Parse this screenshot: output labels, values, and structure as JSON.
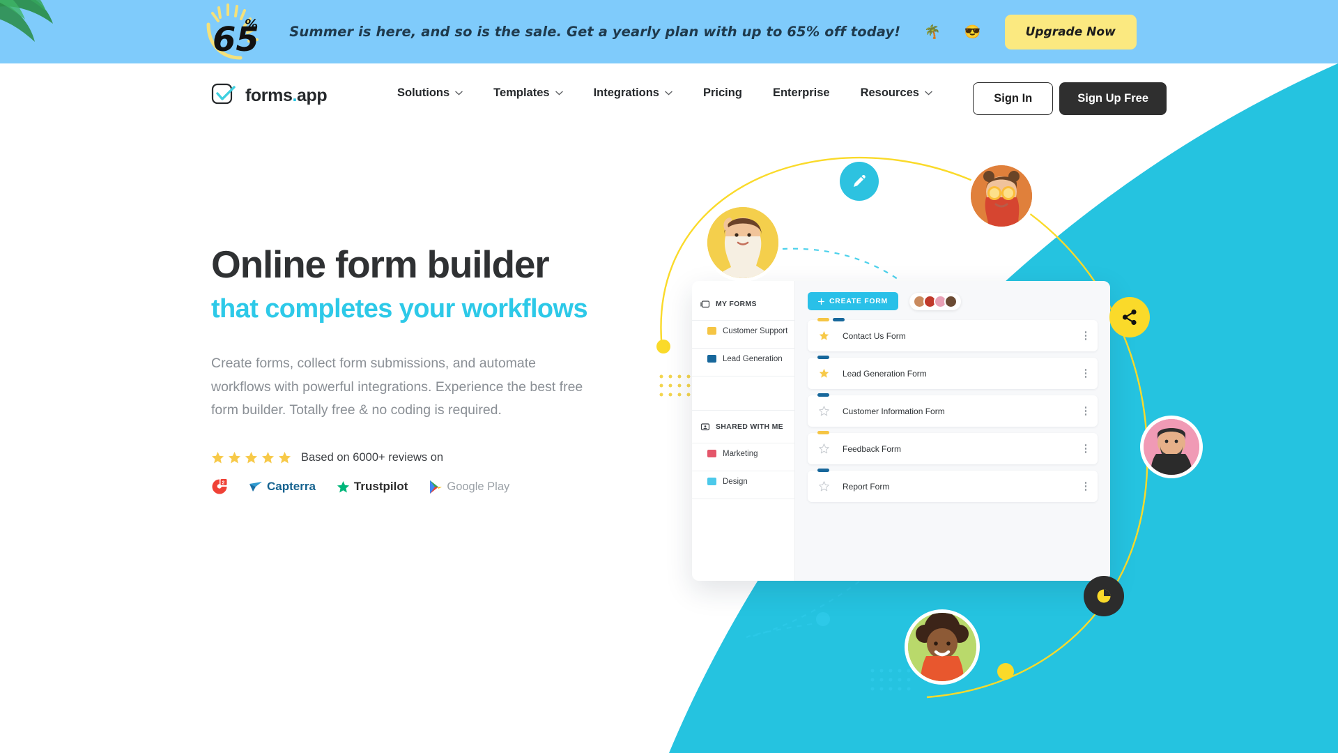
{
  "promo": {
    "badge_number": "65",
    "badge_percent": "%",
    "message": "Summer is here, and so is the sale. Get a yearly plan with up to 65% off today!",
    "emoji_palm": "🌴",
    "emoji_sun": "😎",
    "cta_label": "Upgrade Now",
    "bg_color": "#7fcbfb",
    "cta_bg_color": "#fbe980"
  },
  "nav": {
    "logo_text": "forms",
    "logo_dot": ".",
    "logo_suffix": "app",
    "items": [
      {
        "label": "Solutions",
        "has_caret": true
      },
      {
        "label": "Templates",
        "has_caret": true
      },
      {
        "label": "Integrations",
        "has_caret": true
      },
      {
        "label": "Pricing",
        "has_caret": false
      },
      {
        "label": "Enterprise",
        "has_caret": false
      },
      {
        "label": "Resources",
        "has_caret": true
      }
    ],
    "sign_in_label": "Sign In",
    "sign_up_label": "Sign Up Free"
  },
  "hero": {
    "title": "Online form builder",
    "subtitle": "that completes your workflows",
    "paragraph": "Create forms, collect form submissions, and automate workflows with powerful integrations. Experience the best free form builder. Totally free & no coding is required.",
    "rating_text": "Based on 6000+ reviews on",
    "star_count": 5,
    "star_color": "#f7c948",
    "accent_color": "#2dc9e8",
    "badges": [
      {
        "name": "G2",
        "label": ""
      },
      {
        "name": "Capterra",
        "label": "Capterra"
      },
      {
        "name": "Trustpilot",
        "label": "Trustpilot"
      },
      {
        "name": "Google Play",
        "label": "Google Play"
      }
    ]
  },
  "app_mockup": {
    "sidebar": {
      "my_forms_label": "MY FORMS",
      "shared_label": "SHARED WITH ME",
      "my_forms": [
        {
          "label": "Customer Support",
          "color": "#f5c544"
        },
        {
          "label": "Lead Generation",
          "color": "#17679b"
        }
      ],
      "shared": [
        {
          "label": "Marketing",
          "color": "#e4566a"
        },
        {
          "label": "Design",
          "color": "#4cc9ea"
        }
      ]
    },
    "create_button_label": "CREATE FORM",
    "create_button_icon": "plus-icon",
    "avatar_count": 4,
    "forms": [
      {
        "name": "Contact Us Form",
        "starred": true,
        "tags": [
          "#f5c544",
          "#17679b"
        ]
      },
      {
        "name": "Lead Generation Form",
        "starred": true,
        "tags": [
          "#17679b"
        ]
      },
      {
        "name": "Customer Information Form",
        "starred": false,
        "tags": [
          "#17679b"
        ]
      },
      {
        "name": "Feedback Form",
        "starred": false,
        "tags": [
          "#f5c544"
        ]
      },
      {
        "name": "Report Form",
        "starred": false,
        "tags": [
          "#17679b"
        ]
      }
    ]
  },
  "decor": {
    "cyan_color": "#25c3e0",
    "yellow_color": "#fada2a",
    "dark_color": "#2c2c2c",
    "floating_icons": [
      {
        "name": "pencil-icon",
        "bg": "#2dc2e0"
      },
      {
        "name": "share-icon",
        "bg": "#fada2a"
      },
      {
        "name": "pie-chart-icon",
        "bg": "#2c2c2c"
      }
    ]
  }
}
